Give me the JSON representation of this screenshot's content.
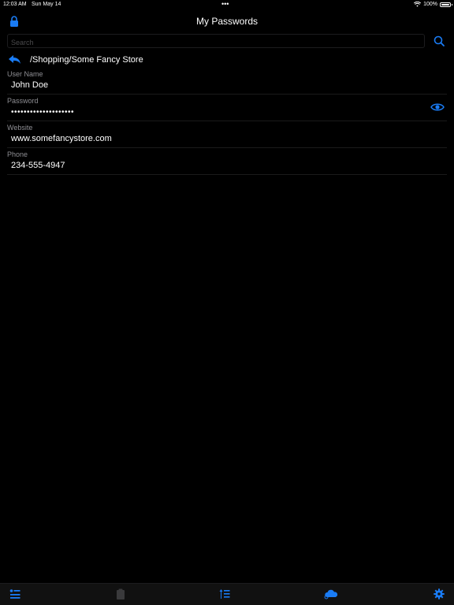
{
  "status_bar": {
    "time": "12:03 AM",
    "date": "Sun May 14",
    "dots": "•••",
    "battery": "100%",
    "icons": [
      "wifi-icon",
      "battery-icon"
    ]
  },
  "header": {
    "title": "My Passwords",
    "lock_icon": "lock-icon"
  },
  "search": {
    "placeholder": "Search",
    "value": "",
    "icon": "search-icon"
  },
  "path": {
    "text": "/Shopping/Some Fancy Store",
    "back_icon": "back-arrow-icon"
  },
  "fields": [
    {
      "label": "User Name",
      "value": "John Doe"
    },
    {
      "label": "Password",
      "value": "••••••••••••••••••••",
      "icon": "eye-icon"
    },
    {
      "label": "Website",
      "value": "www.somefancystore.com"
    },
    {
      "label": "Phone",
      "value": "234-555-4947"
    }
  ],
  "tab_bar": {
    "items": [
      "list-icon",
      "clipboard-icon",
      "sort-icon",
      "cloud-icon",
      "gear-icon"
    ]
  },
  "colors": {
    "background": "#000000",
    "accent": "#1a7cf5",
    "label": "#8e8e93",
    "disabled": "#3a3a3c"
  }
}
